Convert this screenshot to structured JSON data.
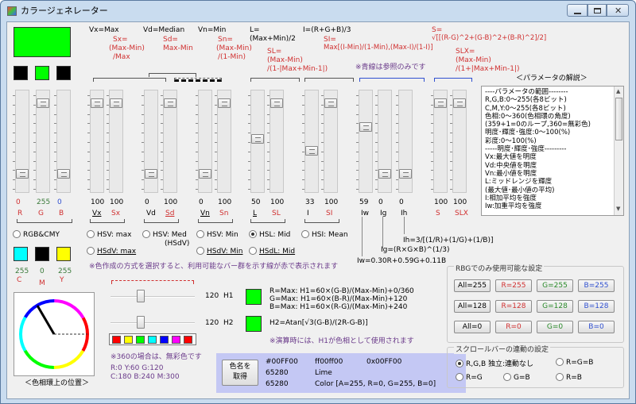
{
  "window": {
    "title": "カラージェネレーター"
  },
  "preview_color": "#00ff00",
  "swatches_top": [
    "#000000",
    "#00ff00",
    "#000000"
  ],
  "headers": {
    "vx": "Vx=Max",
    "vd": "Vd=Median",
    "vn": "Vn=Min",
    "l1": "L=",
    "l2": "(Max+Min)/2",
    "i": "I=(R+G+B)/3",
    "sx1": "Sx=",
    "sx2": "(Max-Min)",
    "sx3": "/Max",
    "sd1": "Sd=",
    "sd2": "Max-Min",
    "sn1": "Sn=",
    "sn2": "(Max-Min)",
    "sn3": "/(1-Min)",
    "sl1": "SL=",
    "sl2": "(Max-Min)",
    "sl3": "/(1-|Max+Min-1|)",
    "si1": "SI=",
    "si2": "Max[(I-Min)/(1-Min),(Max-I)/(1-I)]",
    "s1": "S=",
    "s2": "√[[(R-G)^2+(G-B)^2+(B-R)^2]/2]",
    "slx1": "SLX=",
    "slx2": "(Max-Min)",
    "slx3": "/(1+|Max+Min-1|)",
    "blue_note": "※青線は参照のみです",
    "param_title": "＜パラメータの解説＞"
  },
  "values": {
    "r": "0",
    "g": "255",
    "b": "0",
    "vx": "100",
    "sx": "100",
    "vd": "0",
    "sd": "100",
    "vn": "0",
    "sn": "100",
    "l": "50",
    "sl": "100",
    "i": "33",
    "si": "100",
    "iw": "59",
    "ig": "0",
    "ih": "0",
    "s": "100",
    "slx": "100"
  },
  "labels": {
    "r": "R",
    "g": "G",
    "b": "B",
    "vx": "Vx",
    "sx": "Sx",
    "vd": "Vd",
    "sd": "Sd",
    "vn": "Vn",
    "sn": "Sn",
    "l": "L",
    "sl": "SL",
    "i": "I",
    "si": "SI",
    "iw": "Iw",
    "ig": "Ig",
    "ih": "Ih",
    "s": "S",
    "slx": "SLX"
  },
  "params": [
    "----パラメータの範囲--------",
    "R,G,B:0～255(各8ビット)",
    "C,M,Y:0～255(各8ビット)",
    "色相:0～360(色相環の角度)",
    "(359+1=0のループ,360=無彩色)",
    "明度･輝度･強度:0～100(%)",
    "彩度:0～100(%)",
    "-----明度･輝度･強度---------",
    "Vx:最大値を明度",
    "Vd:中央値を明度",
    "Vn:最小値を明度",
    "L:ミッドレンジを輝度",
    "(最大値･最小値の平均)",
    "I:相加平均を強度",
    "Iw:加重平均を強度"
  ],
  "modes": {
    "rgbcmy": "RGB&CMY",
    "hsv_max": "HSV: max",
    "hsv_med1": "HSV: Med",
    "hsv_med2": "(HSdV)",
    "hsv_min": "HSV: Min",
    "hsl_mid": "HSL: Mid",
    "hsi_mean": "HSI: Mean",
    "hsdv_max": "HSdV: max",
    "hsdv_min": "HSdV: Min",
    "hsdl_mid": "HSdL: Mid"
  },
  "formulas": {
    "ih": "Ih=3/[(1/R)+(1/G)+(1/B)]",
    "ig": "Ig=(R×G×B)^(1/3)",
    "iw": "Iw=0.30R+0.59G+0.11B"
  },
  "cmy_values": {
    "c": "255",
    "m": "0",
    "y": "255"
  },
  "cmy_labels": {
    "c": "C",
    "m": "M",
    "y": "Y"
  },
  "cmy_swatches": [
    "#00ffff",
    "#000000",
    "#ffff00"
  ],
  "mode_note": "※色作成の方式を選択すると、利用可能なバー群を示す線が赤で表示されます",
  "hue_wheel_caption": "＜色相環上の位置＞",
  "hue": {
    "h1_value": "120",
    "h1_label": "H1",
    "h2_value": "120",
    "h2_label": "H2",
    "h1_swatch": "#00ff00",
    "h2_swatch": "#00ff00",
    "palette": [
      "#ff0000",
      "#ffff00",
      "#00ff00",
      "#00ffff",
      "#0000ff",
      "#ff00ff",
      "#ff0000"
    ],
    "h1_formulas": [
      "R=Max: H1=60×(G-B)/(Max-Min)+0/360",
      "G=Max: H1=60×(B-R)/(Max-Min)+120",
      "B=Max: H1=60×(R-G)/(Max-Min)+240"
    ],
    "h2_formula": "H2=Atan[√3(G-B)/(2R-G-B)]",
    "calc_note": "※演算時には、H1が色相として使用されます",
    "achromatic_note": "※360の場合は、無彩色です",
    "hue_list_1": "R:0    Y:60   G:120",
    "hue_list_2": "C:180  B:240  M:300"
  },
  "rgb_panel": {
    "title": "RBGでのみ使用可能な設定",
    "rows": [
      [
        "All=255",
        "R=255",
        "G=255",
        "B=255"
      ],
      [
        "All=128",
        "R=128",
        "G=128",
        "B=128"
      ],
      [
        "All=0",
        "R=0",
        "G=0",
        "B=0"
      ]
    ]
  },
  "scroll_panel": {
    "title": "スクロールバーの連動の設定",
    "opt1": "R,G,B 独立:連動なし",
    "opt2": "R=G=B",
    "opt3": "R=G",
    "opt4": "G=B",
    "opt5": "R=B"
  },
  "get_color_button": {
    "line1": "色名を",
    "line2": "取得"
  },
  "color_output": {
    "hex1": "#00FF00",
    "hex2": "ff00ff00",
    "hex3": "0x00FF00",
    "dec": "65280",
    "name": "Lime",
    "dec2": "65280",
    "color_str": "Color [A=255, R=0, G=255, B=0]"
  }
}
